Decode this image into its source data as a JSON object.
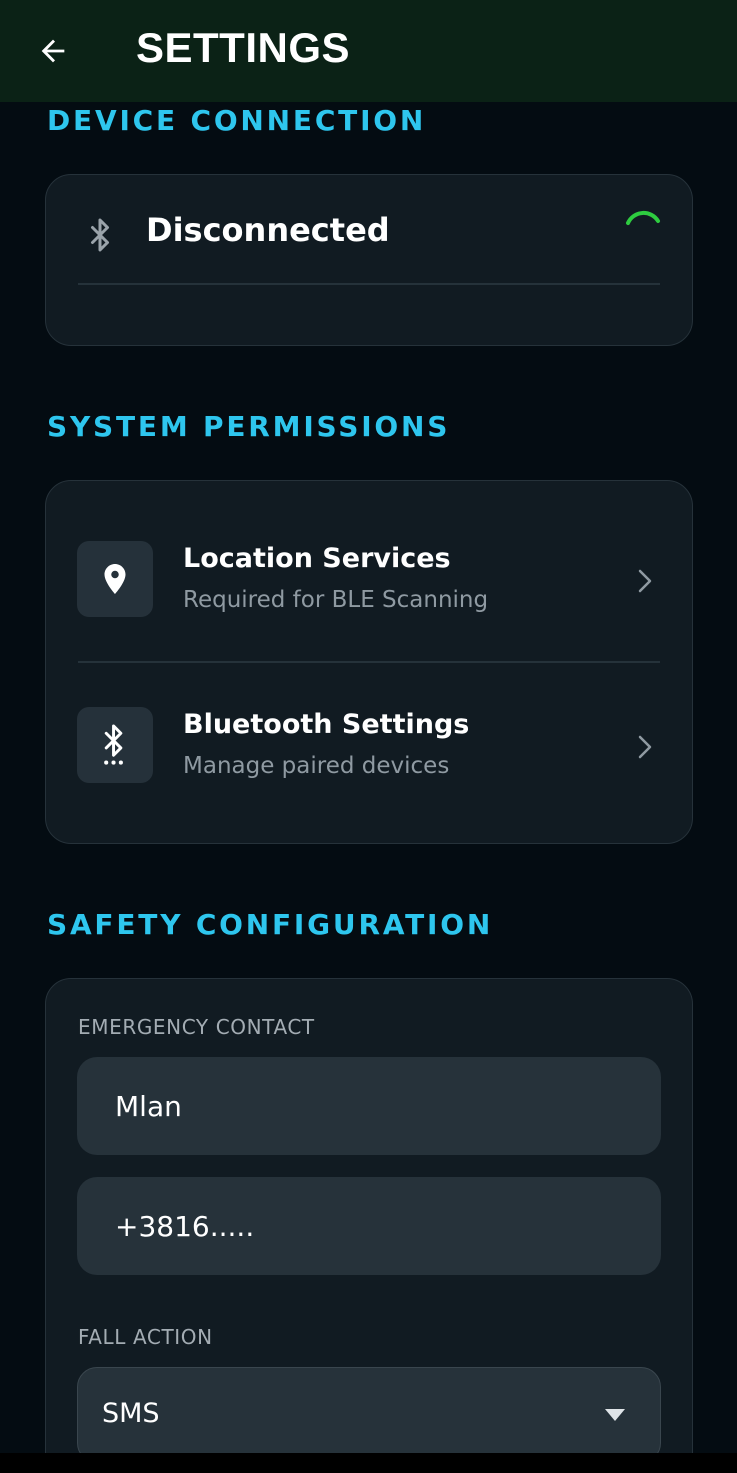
{
  "appbar": {
    "title": "SETTINGS",
    "back_icon": "arrow-left-icon"
  },
  "device_connection": {
    "header": "DEVICE CONNECTION",
    "status": "Disconnected",
    "icon": "bluetooth-icon",
    "spinner_color": "#2ecc40"
  },
  "system_permissions": {
    "header": "SYSTEM PERMISSIONS",
    "items": [
      {
        "title": "Location Services",
        "subtitle": "Required for BLE Scanning",
        "icon": "location-pin-icon"
      },
      {
        "title": "Bluetooth Settings",
        "subtitle": "Manage paired devices",
        "icon": "bluetooth-searching-icon"
      }
    ]
  },
  "safety_configuration": {
    "header": "SAFETY CONFIGURATION",
    "emergency_contact_label": "EMERGENCY CONTACT",
    "contact_name": "Mlan",
    "contact_phone": "+3816.....",
    "fall_action_label": "FALL ACTION",
    "fall_action_value": "SMS"
  },
  "colors": {
    "accent": "#2ec6ee",
    "appbar_bg": "#0b2216",
    "background": "#040c12",
    "card_bg": "#111b22"
  }
}
